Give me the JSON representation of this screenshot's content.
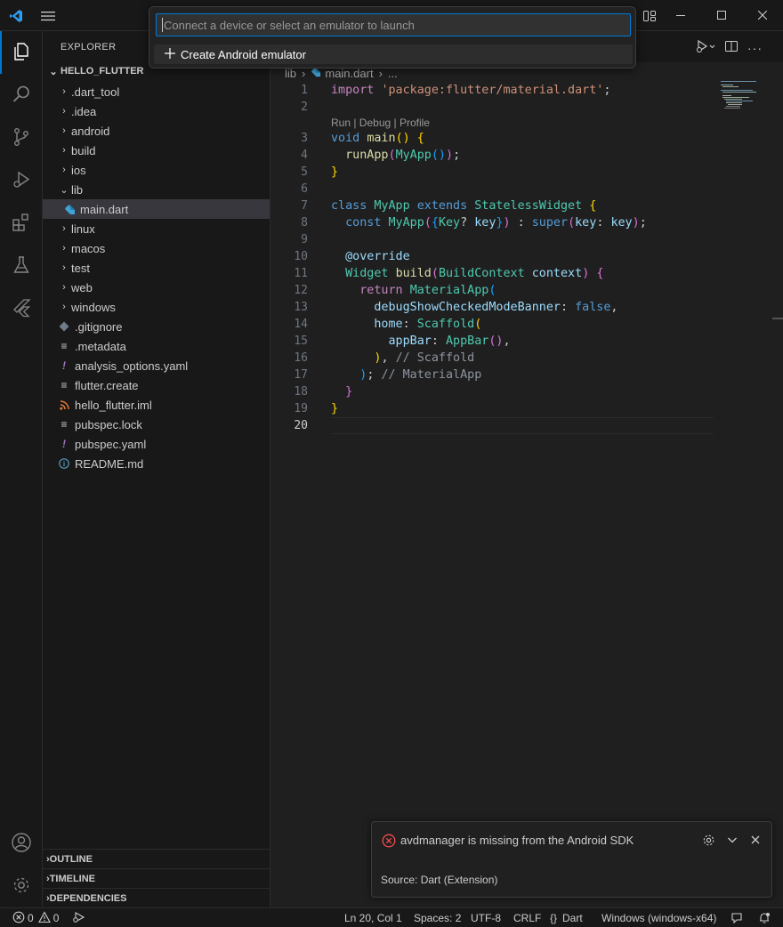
{
  "titlebar": {
    "icons": [
      "vscode-logo-icon",
      "menu-icon",
      "layout-icon",
      "minimize-icon",
      "maximize-icon",
      "close-icon"
    ]
  },
  "quick_pick": {
    "placeholder": "Connect a device or select an emulator to launch",
    "items": [
      {
        "label": "Create Android emulator",
        "icon": "plus-icon"
      }
    ]
  },
  "activity_bar": {
    "items": [
      "explorer-icon",
      "search-icon",
      "source-control-icon",
      "run-debug-icon",
      "extensions-icon",
      "testing-icon",
      "flutter-icon"
    ],
    "bottom": [
      "account-icon",
      "manage-gear-icon"
    ]
  },
  "sidebar": {
    "title": "EXPLORER",
    "root": "HELLO_FLUTTER",
    "tree": [
      {
        "label": ".dart_tool",
        "kind": "folder"
      },
      {
        "label": ".idea",
        "kind": "folder"
      },
      {
        "label": "android",
        "kind": "folder"
      },
      {
        "label": "build",
        "kind": "folder"
      },
      {
        "label": "ios",
        "kind": "folder"
      },
      {
        "label": "lib",
        "kind": "folder-open"
      },
      {
        "label": "main.dart",
        "kind": "dart-file"
      },
      {
        "label": "linux",
        "kind": "folder"
      },
      {
        "label": "macos",
        "kind": "folder"
      },
      {
        "label": "test",
        "kind": "folder"
      },
      {
        "label": "web",
        "kind": "folder"
      },
      {
        "label": "windows",
        "kind": "folder"
      },
      {
        "label": ".gitignore",
        "kind": "git-file"
      },
      {
        "label": ".metadata",
        "kind": "lines-file"
      },
      {
        "label": "analysis_options.yaml",
        "kind": "yaml-file"
      },
      {
        "label": "flutter.create",
        "kind": "lines-file"
      },
      {
        "label": "hello_flutter.iml",
        "kind": "rss-file"
      },
      {
        "label": "pubspec.lock",
        "kind": "lines-file"
      },
      {
        "label": "pubspec.yaml",
        "kind": "yaml-file"
      },
      {
        "label": "README.md",
        "kind": "info-file"
      }
    ],
    "panels": [
      "OUTLINE",
      "TIMELINE",
      "DEPENDENCIES"
    ]
  },
  "editor": {
    "breadcrumb": {
      "folder": "lib",
      "file": "main.dart",
      "more": "..."
    },
    "codelens": "Run | Debug | Profile",
    "line_numbers": [
      "1",
      "2",
      "3",
      "4",
      "5",
      "6",
      "7",
      "8",
      "9",
      "10",
      "11",
      "12",
      "13",
      "14",
      "15",
      "16",
      "17",
      "18",
      "19",
      "20"
    ],
    "code": {
      "l1_import": "import",
      "l1_str": "'package:flutter/material.dart'",
      "l1_end": ";",
      "void": "void",
      "main": "main",
      "runApp": "runApp",
      "MyApp": "MyApp",
      "class": "class",
      "extends": "extends",
      "StatelessWidget": "StatelessWidget",
      "const": "const",
      "Key": "Key",
      "key": "key",
      "super": "super",
      "override": "@override",
      "Widget": "Widget",
      "build": "build",
      "BuildContext": "BuildContext",
      "context": "context",
      "return": "return",
      "MaterialApp": "MaterialApp",
      "debugBanner": "debugShowCheckedModeBanner",
      "false": "false",
      "home": "home",
      "Scaffold": "Scaffold",
      "appBar": "appBar",
      "AppBar": "AppBar",
      "cmt_scaffold": "// Scaffold",
      "cmt_materialapp": "// MaterialApp"
    }
  },
  "notification": {
    "message": "avdmanager is missing from the Android SDK",
    "source": "Source: Dart (Extension)",
    "icons": [
      "error-icon",
      "settings-gear-icon",
      "collapse-chevron-icon",
      "close-icon"
    ]
  },
  "statusbar": {
    "errors": "0",
    "warnings": "0",
    "position": "Ln 20, Col 1",
    "spaces": "Spaces: 2",
    "encoding": "UTF-8",
    "eol": "CRLF",
    "language_braces": "{}",
    "language": "Dart",
    "device": "Windows (windows-x64)"
  },
  "colors": {
    "accent": "#0078d4",
    "error": "#f14c4c",
    "background": "#1f1f1f",
    "sidebar": "#181818"
  }
}
